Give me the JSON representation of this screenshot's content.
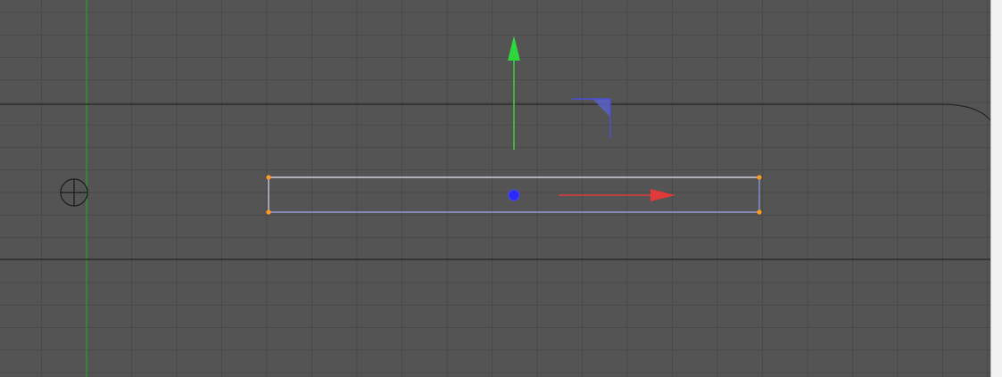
{
  "viewport": {
    "background": "#545454",
    "grid": true,
    "grid_color": "#4a4a4a",
    "y_axis_color": "#1fae1f",
    "border_color": "#2b2b2b"
  },
  "gizmo": {
    "x_axis": {
      "icon": "x-axis-arrow-icon",
      "color": "#e03a3a"
    },
    "y_axis": {
      "icon": "y-axis-arrow-icon",
      "color": "#2fd83a"
    },
    "plane_handle": {
      "icon": "xy-plane-handle-icon",
      "color": "#4a4fd8"
    },
    "center": {
      "icon": "pivot-point-icon",
      "color": "#2a2aff"
    }
  },
  "selection": {
    "outline_color": "#dcdcf0",
    "handle_color": "#ff9a1e"
  },
  "origin_marker": {
    "icon": "crosshair-icon"
  }
}
